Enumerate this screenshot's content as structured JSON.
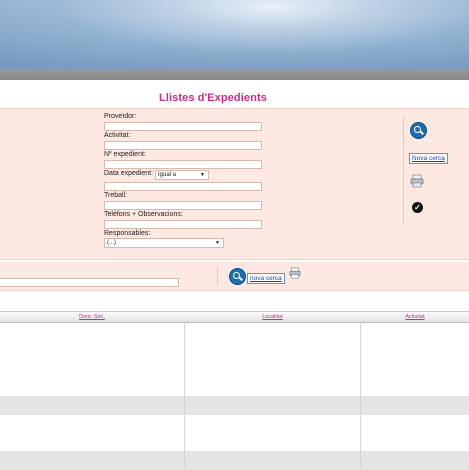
{
  "page": {
    "title": "Llistes d'Expedients"
  },
  "form": {
    "proveidor_label": "Proveïdor:",
    "activitat_label": "Activitat:",
    "expedient_label": "Nº expedient:",
    "data_label": "Data expedient:",
    "data_operator": "Igual a",
    "treball_label": "Treball:",
    "telefons_label": "Telèfons + Observacions:",
    "responsables_label": "Responsables:",
    "responsables_value": "(...)"
  },
  "side_actions": {
    "new_search_label": "Nova cerca"
  },
  "search_band": {
    "new_search_label": "nova cerca"
  },
  "table": {
    "columns": [
      "Dom. Soc.",
      "Localitat",
      "Activitat"
    ]
  },
  "icons": {
    "search": "search-icon",
    "print": "printer-icon",
    "check": "check-icon",
    "dropdown": "chevron-down-icon"
  },
  "colors": {
    "title": "#cc2a8c",
    "panel": "#fde8e2",
    "link": "#1d3fae",
    "icon_blue": "#1d6fb0"
  }
}
